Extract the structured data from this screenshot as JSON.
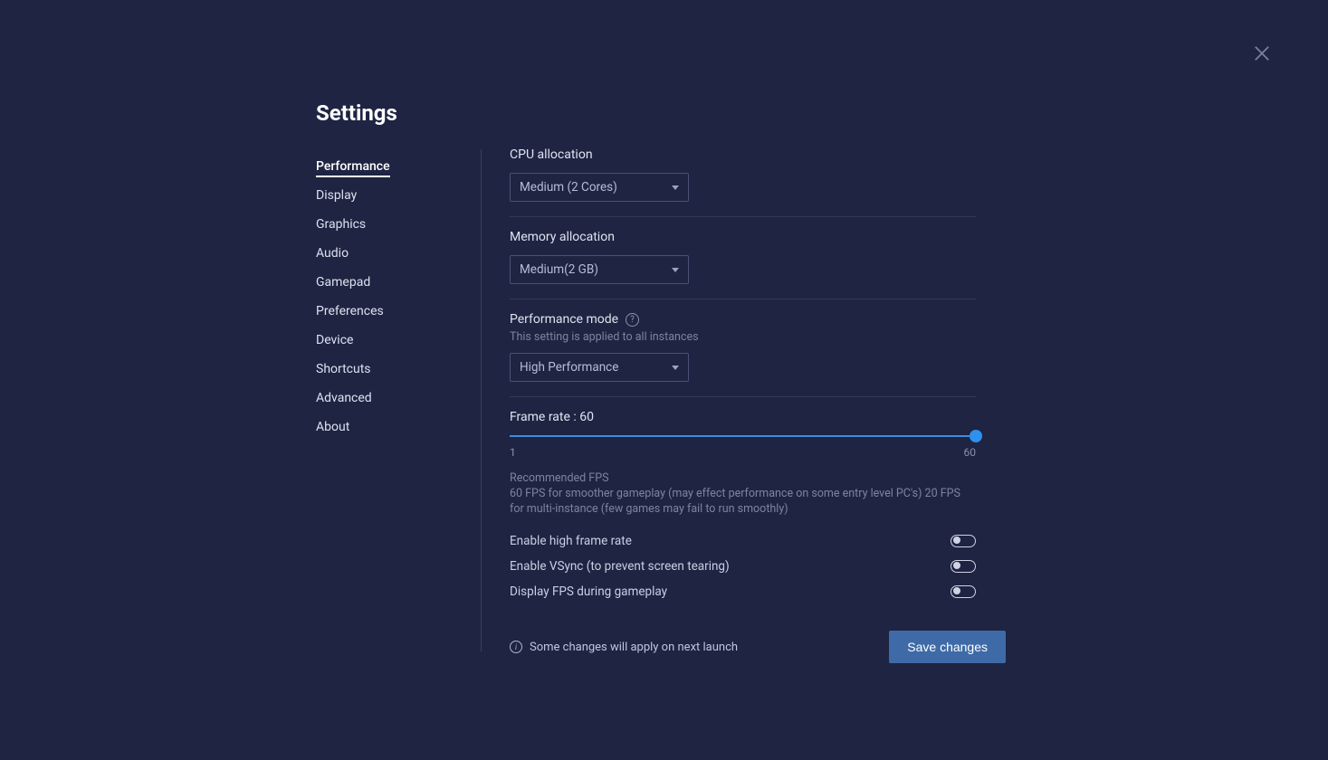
{
  "page_title": "Settings",
  "sidebar": {
    "items": [
      {
        "label": "Performance",
        "active": true
      },
      {
        "label": "Display",
        "active": false
      },
      {
        "label": "Graphics",
        "active": false
      },
      {
        "label": "Audio",
        "active": false
      },
      {
        "label": "Gamepad",
        "active": false
      },
      {
        "label": "Preferences",
        "active": false
      },
      {
        "label": "Device",
        "active": false
      },
      {
        "label": "Shortcuts",
        "active": false
      },
      {
        "label": "Advanced",
        "active": false
      },
      {
        "label": "About",
        "active": false
      }
    ]
  },
  "sections": {
    "cpu": {
      "label": "CPU allocation",
      "value": "Medium (2 Cores)"
    },
    "memory": {
      "label": "Memory allocation",
      "value": "Medium(2 GB)"
    },
    "perf_mode": {
      "label": "Performance mode",
      "subhint": "This setting is applied to all instances",
      "value": "High Performance"
    },
    "frame_rate": {
      "label_prefix": "Frame rate : ",
      "value": 60,
      "min": 1,
      "max": 60,
      "min_label": "1",
      "max_label": "60",
      "rec_title": "Recommended FPS",
      "rec_body": "60 FPS for smoother gameplay (may effect performance on some entry level PC's) 20 FPS for multi-instance (few games may fail to run smoothly)"
    },
    "toggles": {
      "high_fps": {
        "label": "Enable high frame rate",
        "on": false
      },
      "vsync": {
        "label": "Enable VSync (to prevent screen tearing)",
        "on": false
      },
      "display_fps": {
        "label": "Display FPS during gameplay",
        "on": false
      }
    }
  },
  "footer": {
    "note": "Some changes will apply on next launch",
    "save_label": "Save changes"
  }
}
